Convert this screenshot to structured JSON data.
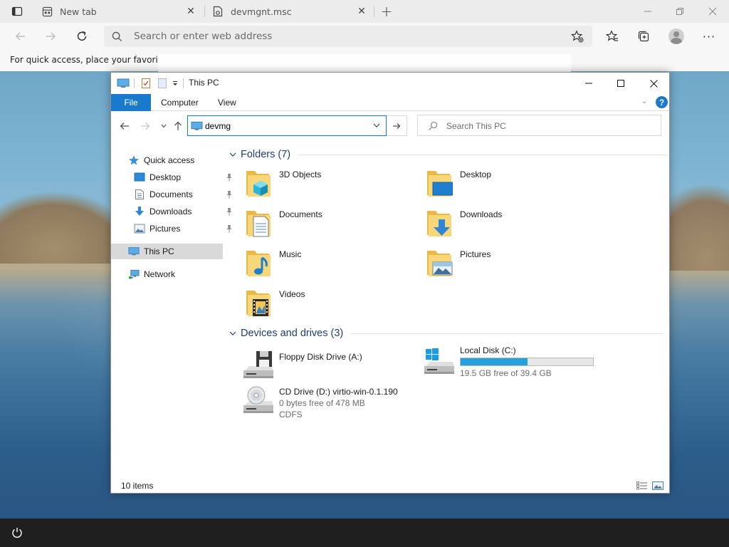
{
  "browser": {
    "tabs": [
      {
        "title": "New tab",
        "icon": "new-tab-page-icon"
      },
      {
        "title": "devmgnt.msc",
        "icon": "file-icon"
      }
    ],
    "address_placeholder": "Search or enter web address",
    "favorites_message": "For quick access, place your favorites h"
  },
  "explorer": {
    "title": "This PC",
    "ribbon_tabs": [
      "File",
      "Computer",
      "View"
    ],
    "address_value": "devmg",
    "search_placeholder": "Search This PC",
    "nav": [
      {
        "label": "Quick access",
        "icon": "star-icon"
      },
      {
        "label": "Desktop",
        "icon": "desktop-icon",
        "pinned": true
      },
      {
        "label": "Documents",
        "icon": "documents-icon",
        "pinned": true
      },
      {
        "label": "Downloads",
        "icon": "downloads-icon",
        "pinned": true
      },
      {
        "label": "Pictures",
        "icon": "pictures-icon",
        "pinned": true
      },
      {
        "label": "This PC",
        "icon": "this-pc-icon",
        "selected": true
      },
      {
        "label": "Network",
        "icon": "network-icon"
      }
    ],
    "folders_header": "Folders (7)",
    "folders": [
      {
        "name": "3D Objects",
        "icon": "3d-objects-folder-icon"
      },
      {
        "name": "Desktop",
        "icon": "desktop-folder-icon"
      },
      {
        "name": "Documents",
        "icon": "documents-folder-icon"
      },
      {
        "name": "Downloads",
        "icon": "downloads-folder-icon"
      },
      {
        "name": "Music",
        "icon": "music-folder-icon"
      },
      {
        "name": "Pictures",
        "icon": "pictures-folder-icon"
      },
      {
        "name": "Videos",
        "icon": "videos-folder-icon"
      }
    ],
    "drives_header": "Devices and drives (3)",
    "drives": [
      {
        "name": "Floppy Disk Drive (A:)",
        "icon": "floppy-drive-icon"
      },
      {
        "name": "Local Disk (C:)",
        "icon": "local-disk-icon",
        "free_text": "19.5 GB free of 39.4 GB",
        "used_fraction": 0.505
      },
      {
        "name": "CD Drive (D:) virtio-win-0.1.190",
        "icon": "cd-drive-icon",
        "free_text": "0 bytes free of 478 MB",
        "filesystem": "CDFS"
      }
    ],
    "status": "10 items",
    "accent": "#1979ca"
  }
}
